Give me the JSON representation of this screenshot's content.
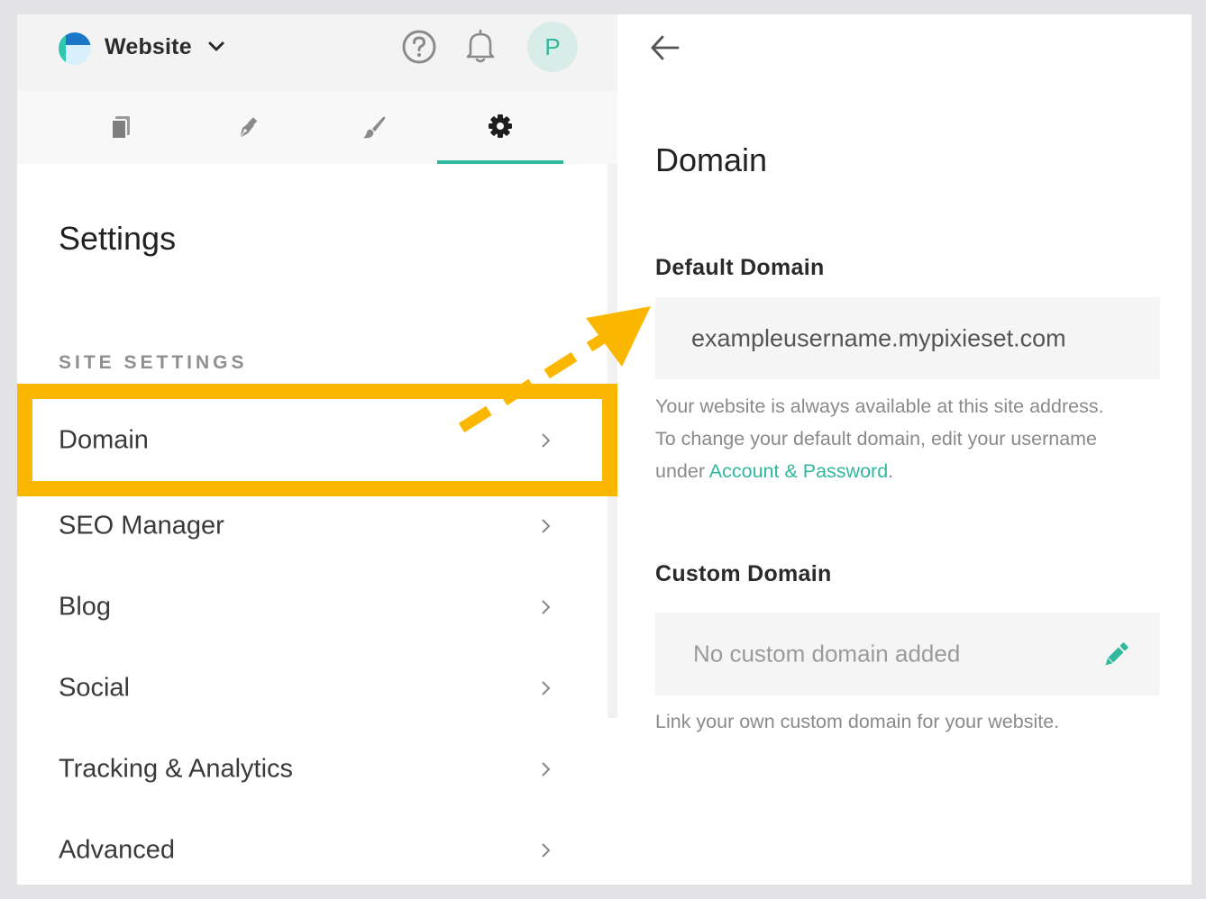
{
  "header": {
    "site_name": "Website",
    "avatar_initial": "P"
  },
  "tabs": [
    {
      "icon": "pages-icon"
    },
    {
      "icon": "pen-nib-icon"
    },
    {
      "icon": "paintbrush-icon"
    },
    {
      "icon": "gear-icon",
      "active": true
    }
  ],
  "sidebar": {
    "title": "Settings",
    "section_label": "SITE SETTINGS",
    "items": [
      {
        "label": "Domain",
        "highlighted": true
      },
      {
        "label": "SEO Manager"
      },
      {
        "label": "Blog"
      },
      {
        "label": "Social"
      },
      {
        "label": "Tracking & Analytics"
      },
      {
        "label": "Advanced"
      }
    ]
  },
  "detail": {
    "title": "Domain",
    "default_domain": {
      "heading": "Default Domain",
      "value": "exampleusername.mypixieset.com",
      "help_line1": "Your website is always available at this site address.",
      "help_line2": "To change your default domain, edit your username",
      "help_line3_prefix": "under ",
      "help_link": "Account & Password",
      "help_line3_suffix": "."
    },
    "custom_domain": {
      "heading": "Custom Domain",
      "placeholder": "No custom domain added",
      "help": "Link your own custom domain for your website."
    }
  },
  "colors": {
    "accent": "#2fb89c",
    "highlight": "#fbb700"
  }
}
